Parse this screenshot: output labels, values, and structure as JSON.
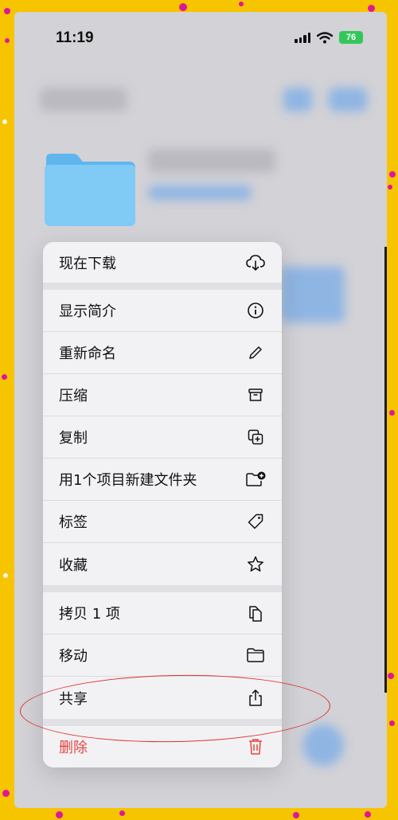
{
  "status_bar": {
    "time": "11:19",
    "battery": "76"
  },
  "menu": {
    "items": [
      {
        "label": "现在下载",
        "icon": "cloud-download-icon"
      },
      {
        "label": "显示简介",
        "icon": "info-icon"
      },
      {
        "label": "重新命名",
        "icon": "pencil-icon"
      },
      {
        "label": "压缩",
        "icon": "archive-box-icon"
      },
      {
        "label": "复制",
        "icon": "duplicate-icon"
      },
      {
        "label": "用1个项目新建文件夹",
        "icon": "folder-plus-icon"
      },
      {
        "label": "标签",
        "icon": "tag-icon"
      },
      {
        "label": "收藏",
        "icon": "star-icon"
      },
      {
        "label": "拷贝 1 项",
        "icon": "copy-docs-icon"
      },
      {
        "label": "移动",
        "icon": "folder-icon"
      },
      {
        "label": "共享",
        "icon": "share-icon"
      },
      {
        "label": "删除",
        "icon": "trash-icon"
      }
    ]
  },
  "colors": {
    "frame": "#f7c400",
    "confetti": "#e0159b",
    "destructive": "#e8453c",
    "folder": "#7cc8f6",
    "annotation": "#e0302a"
  }
}
